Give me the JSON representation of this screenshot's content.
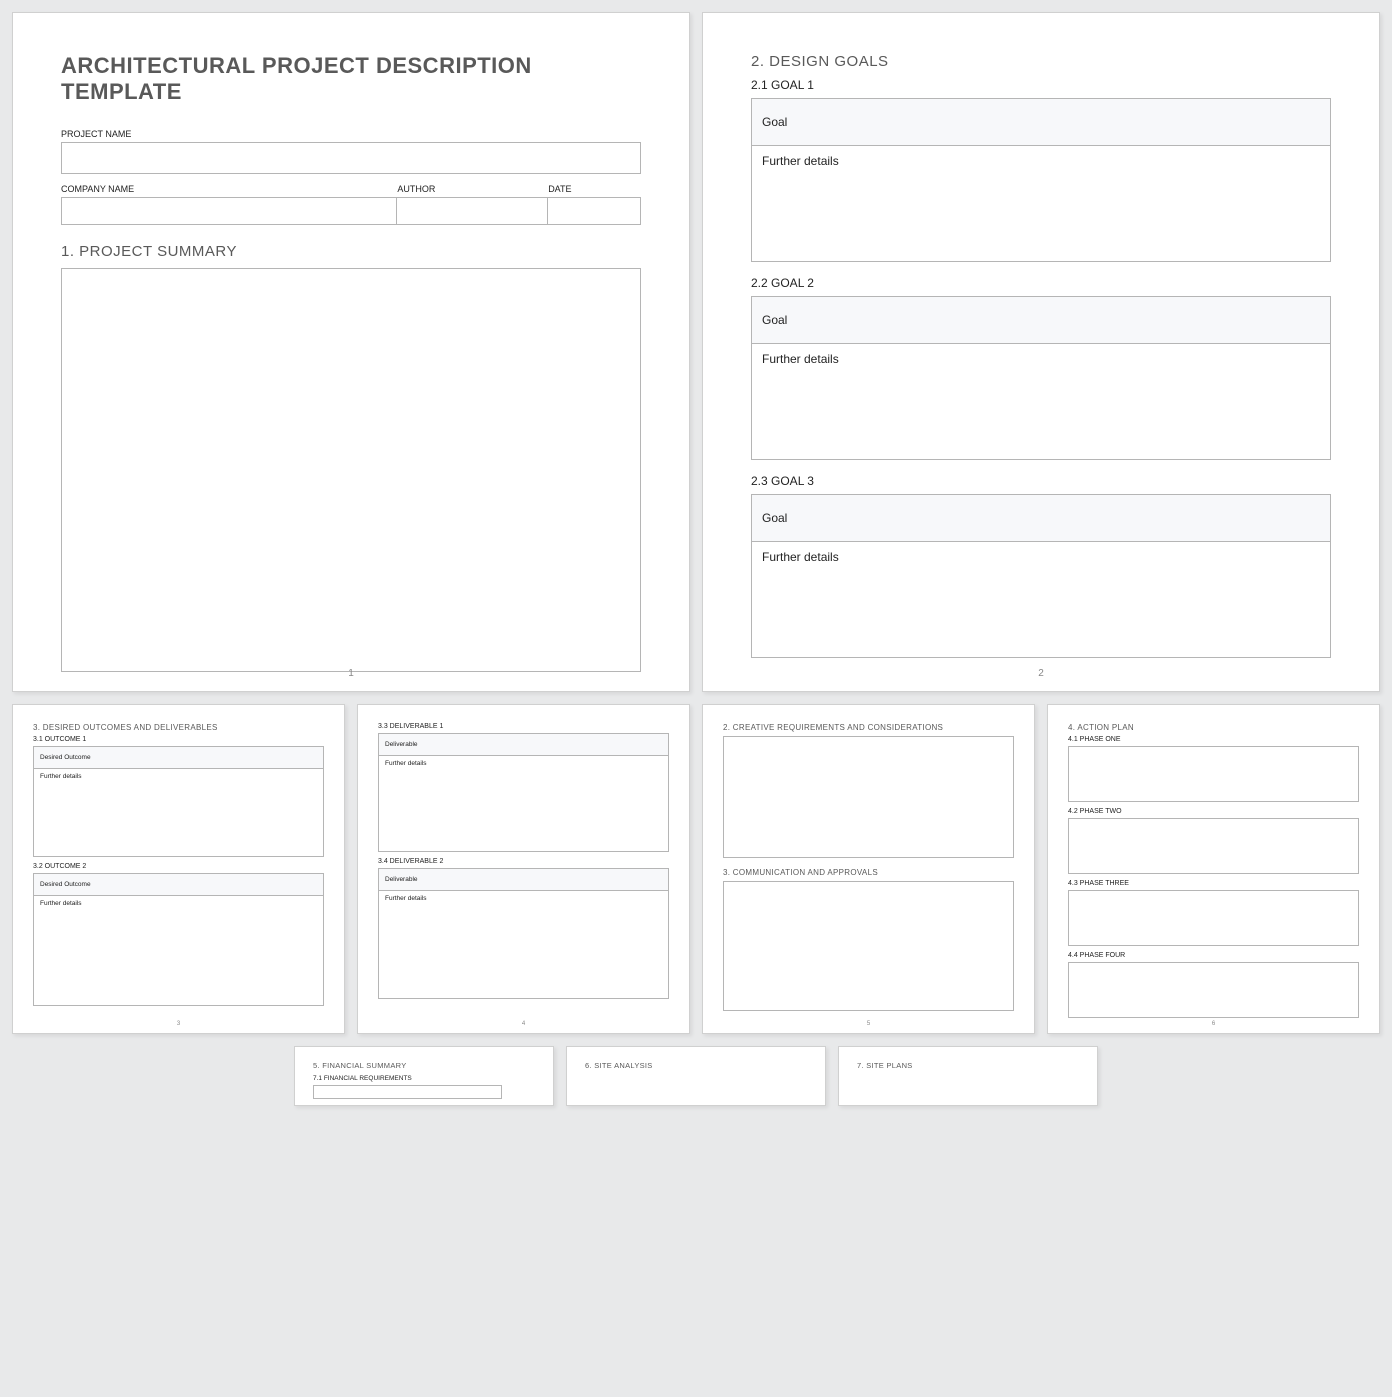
{
  "p1": {
    "title": "ARCHITECTURAL PROJECT DESCRIPTION TEMPLATE",
    "project_name_label": "PROJECT NAME",
    "company_name_label": "COMPANY NAME",
    "author_label": "AUTHOR",
    "date_label": "DATE",
    "section1": "1.  PROJECT SUMMARY",
    "pgnum": "1"
  },
  "p2": {
    "section2": "2.  DESIGN GOALS",
    "goals": [
      {
        "sub": "2.1 GOAL 1",
        "head": "Goal",
        "body": "Further details"
      },
      {
        "sub": "2.2 GOAL 2",
        "head": "Goal",
        "body": "Further details"
      },
      {
        "sub": "2.3 GOAL 3",
        "head": "Goal",
        "body": "Further details"
      }
    ],
    "pgnum": "2"
  },
  "p3": {
    "section": "3.  DESIRED OUTCOMES AND DELIVERABLES",
    "o1_sub": "3.1 OUTCOME 1",
    "o1_head": "Desired Outcome",
    "o1_body": "Further details",
    "o2_sub": "3.2 OUTCOME 2",
    "o2_head": "Desired Outcome",
    "o2_body": "Further details",
    "pgnum": "3"
  },
  "p4": {
    "d3_sub": "3.3 DELIVERABLE 1",
    "d3_head": "Deliverable",
    "d3_body": "Further details",
    "d4_sub": "3.4 DELIVERABLE 2",
    "d4_head": "Deliverable",
    "d4_body": "Further details",
    "pgnum": "4"
  },
  "p5": {
    "section2": "2.  CREATIVE REQUIREMENTS AND CONSIDERATIONS",
    "section3": "3.  COMMUNICATION AND APPROVALS",
    "pgnum": "5"
  },
  "p6": {
    "section": "4.  ACTION PLAN",
    "ph1": "4.1 PHASE ONE",
    "ph2": "4.2 PHASE TWO",
    "ph3": "4.3 PHASE THREE",
    "ph4": "4.4 PHASE FOUR",
    "pgnum": "6"
  },
  "p7": {
    "section": "5.  FINANCIAL SUMMARY",
    "sub": "7.1 FINANCIAL REQUIREMENTS"
  },
  "p8": {
    "section": "6.  SITE ANALYSIS"
  },
  "p9": {
    "section": "7.  SITE PLANS"
  }
}
